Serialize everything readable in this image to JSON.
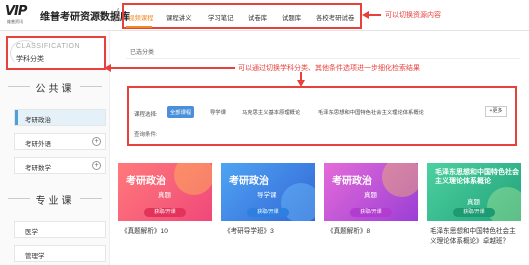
{
  "header": {
    "logo_text": "VIP",
    "logo_subtext": "维普资讯",
    "app_title": "维普考研资源数据库",
    "nav_items": [
      "视频课程",
      "课程讲义",
      "学习笔记",
      "试卷库",
      "试题库",
      "各校考研试卷"
    ],
    "active_nav": "视频课程"
  },
  "annotations": {
    "nav_note": "可以切换资源内容",
    "filter_note": "可以通过切换学科分类、其他条件选项进一步细化检索结果"
  },
  "sidebar": {
    "classification_en": "CLASSIFICATION",
    "classification_zh": "学科分类",
    "section_public": "公共课",
    "public_items": [
      {
        "label": "考研政治",
        "active": true,
        "expandable": false
      },
      {
        "label": "考研外语",
        "active": false,
        "expandable": true
      },
      {
        "label": "考研数学",
        "active": false,
        "expandable": true
      }
    ],
    "section_major": "专业课",
    "major_items": [
      {
        "label": "医学"
      },
      {
        "label": "管理学"
      }
    ],
    "plus_symbol": "+"
  },
  "main": {
    "breadcrumb": "已选分类",
    "filter": {
      "course_label": "课程选择:",
      "chips": [
        "全部课程",
        "导学课",
        "马克思主义基本原理概论",
        "毛泽东思想和中国特色社会主义理论体系概论"
      ],
      "active_chip": "全部课程",
      "more_label": "+更多",
      "query_label": "查询条件:"
    },
    "cards": [
      {
        "title": "考研政治",
        "subtitle": "真题",
        "badge": "获取/开课",
        "caption": "《真题解析》10",
        "bg": "#f25b6d"
      },
      {
        "title": "考研政治",
        "subtitle": "导学课",
        "badge": "获取/开课",
        "caption": "《考研导学班》3",
        "bg": "#3f8fe8"
      },
      {
        "title": "考研政治",
        "subtitle": "真题",
        "badge": "获取/开课",
        "caption": "《真题解析》8",
        "bg": "#c452d9"
      },
      {
        "title": "毛泽东思想和中国特色社会主义理论体系概论",
        "subtitle": "真题",
        "badge": "获取/开课",
        "caption": "毛泽东思想和中国特色社会主义理论体系概论》卓越班？",
        "bg": "#36b98a"
      }
    ]
  },
  "colors": {
    "accent_red": "#e8413c",
    "active_orange": "#f08a24",
    "blue": "#4a8fd9"
  }
}
